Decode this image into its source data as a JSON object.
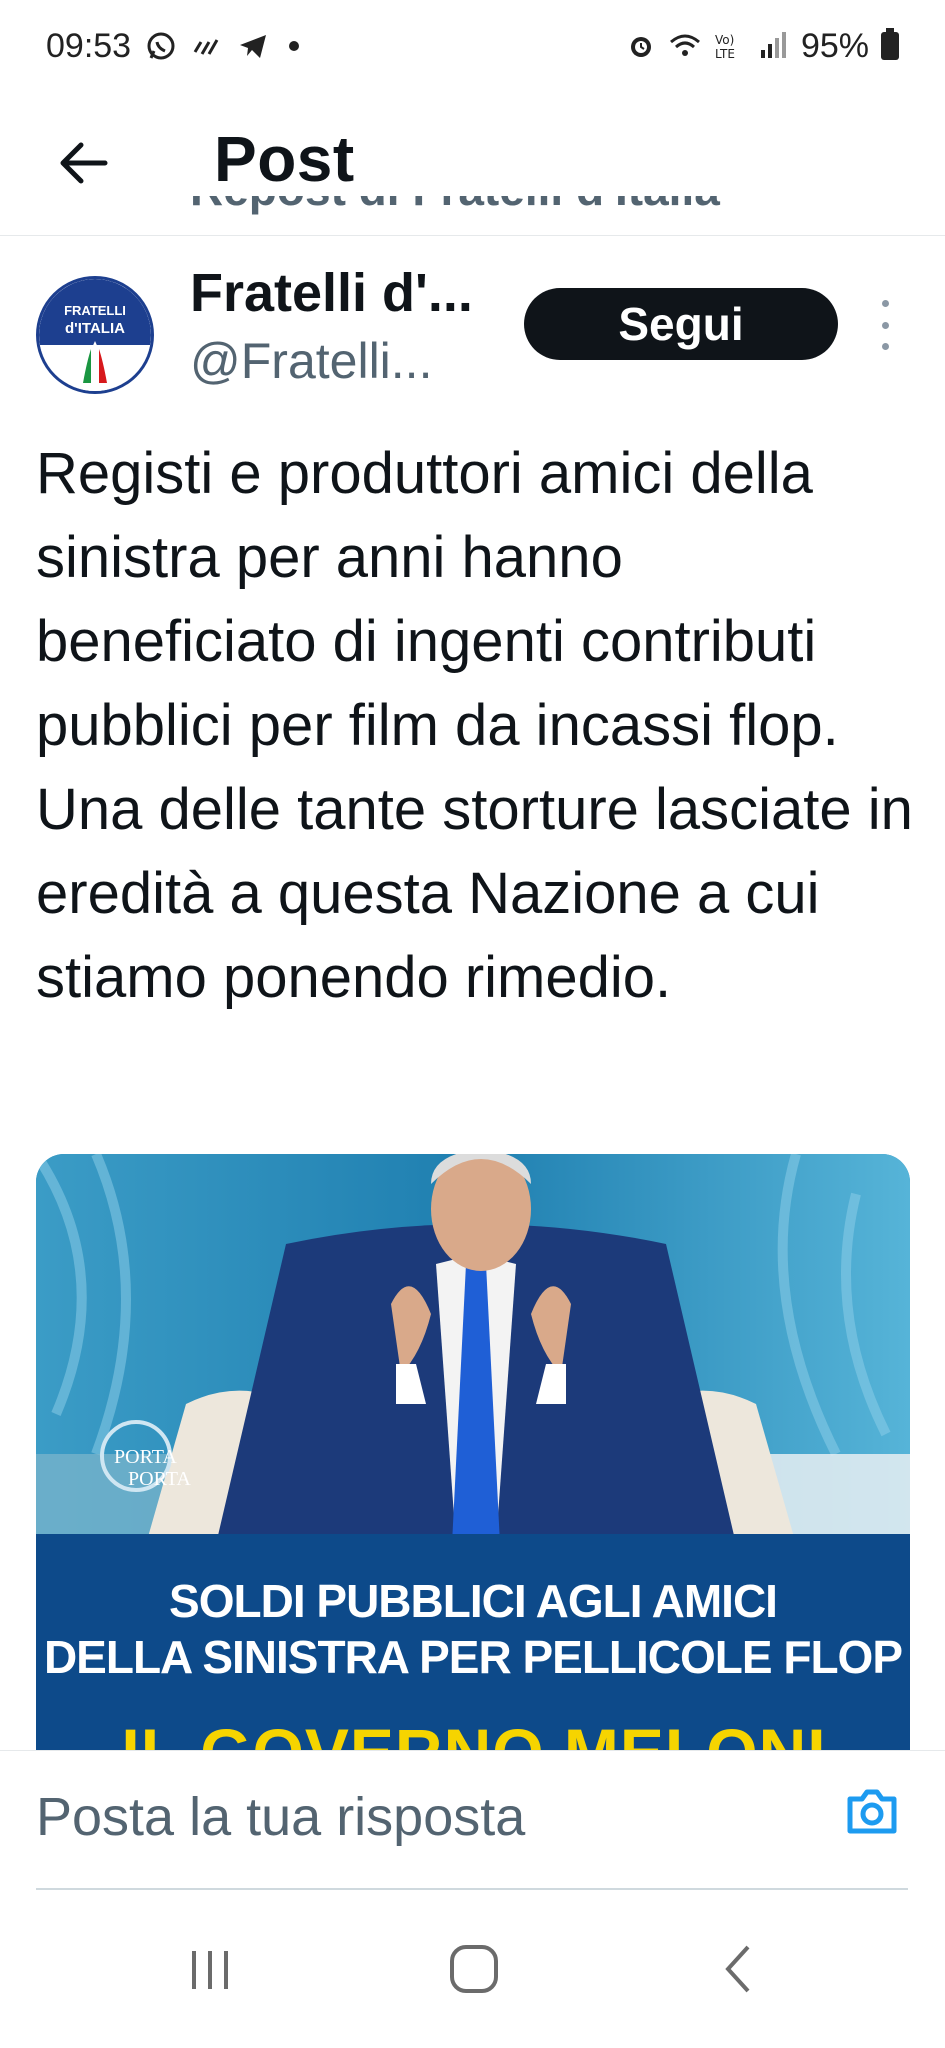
{
  "status_bar": {
    "time": "09:53",
    "battery": "95%",
    "network": "LTE"
  },
  "header": {
    "back_icon": "arrow-left-icon",
    "title": "Post"
  },
  "repost": {
    "label": "Repost di Fratelli d'Italia"
  },
  "author": {
    "avatar_line1": "FRATELLI",
    "avatar_line2": "d'ITALIA",
    "name": "Fratelli d'...",
    "handle": "@Fratelli...",
    "follow_label": "Segui"
  },
  "post": {
    "text": "Registi e produttori amici della sinistra per anni hanno beneficiato di ingenti contributi pubblici per film da incassi flop. Una delle tante storture lasciate in eredità a questa Nazione a cui stiamo ponendo rimedio."
  },
  "media": {
    "logo_line1": "PORTA",
    "logo_line2": "PORTA",
    "caption_line1": "SOLDI PUBBLICI AGLI AMICI",
    "caption_line2": "DELLA SINISTRA PER PELLICOLE FLOP",
    "caption_line3": "IL GOVERNO MELONI"
  },
  "reply": {
    "placeholder": "Posta la tua risposta",
    "camera_icon": "camera-icon"
  },
  "nav": {
    "recents_icon": "recents-icon",
    "home_icon": "home-icon",
    "back_icon": "back-chevron-icon"
  },
  "colors": {
    "primary_text": "#0f1419",
    "secondary_text": "#536471",
    "accent": "#1d9bf0",
    "follow_bg": "#0f1419"
  }
}
